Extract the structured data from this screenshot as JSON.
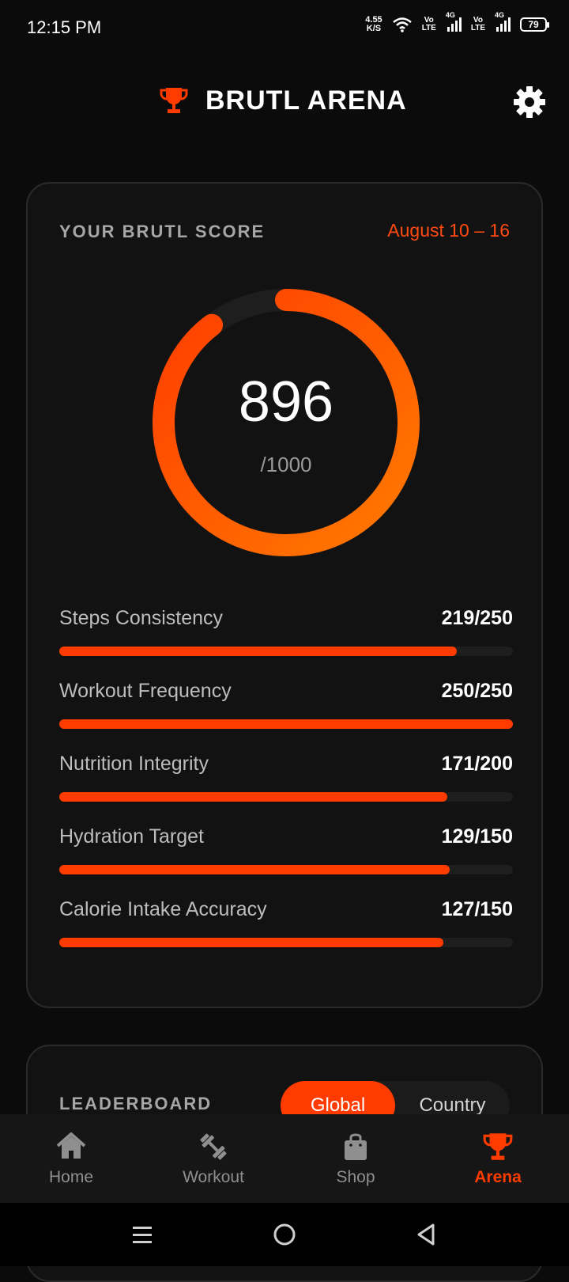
{
  "status_bar": {
    "time": "12:15 PM",
    "net_speed_value": "4.55",
    "net_speed_unit": "K/S",
    "volte_1": [
      "Vo",
      "LTE"
    ],
    "network_1": "4G",
    "volte_2": [
      "Vo",
      "LTE"
    ],
    "network_2": "4G",
    "battery": "79"
  },
  "header": {
    "title": "BRUTL ARENA",
    "logo_icon": "trophy-icon",
    "settings_icon": "gear-icon"
  },
  "score_card": {
    "label": "YOUR BRUTL SCORE",
    "date_range": "August 10 – 16",
    "score": "896",
    "max": "/1000",
    "score_fraction": 0.896,
    "metrics": [
      {
        "name": "Steps Consistency",
        "value": "219/250",
        "fraction": 0.876
      },
      {
        "name": "Workout Frequency",
        "value": "250/250",
        "fraction": 1.0
      },
      {
        "name": "Nutrition Integrity",
        "value": "171/200",
        "fraction": 0.855
      },
      {
        "name": "Hydration Target",
        "value": "129/150",
        "fraction": 0.86
      },
      {
        "name": "Calorie Intake Accuracy",
        "value": "127/150",
        "fraction": 0.847
      }
    ]
  },
  "leaderboard": {
    "label": "LEADERBOARD",
    "tabs": [
      "Global",
      "Country"
    ],
    "active_tab": "Global"
  },
  "bottom_nav": {
    "items": [
      {
        "label": "Home",
        "icon": "home-icon"
      },
      {
        "label": "Workout",
        "icon": "dumbbell-icon"
      },
      {
        "label": "Shop",
        "icon": "shopping-bag-icon"
      },
      {
        "label": "Arena",
        "icon": "trophy-icon"
      }
    ],
    "active": "Arena"
  },
  "colors": {
    "accent": "#ff3b00",
    "background": "#0b0b0b",
    "card": "#121212"
  }
}
